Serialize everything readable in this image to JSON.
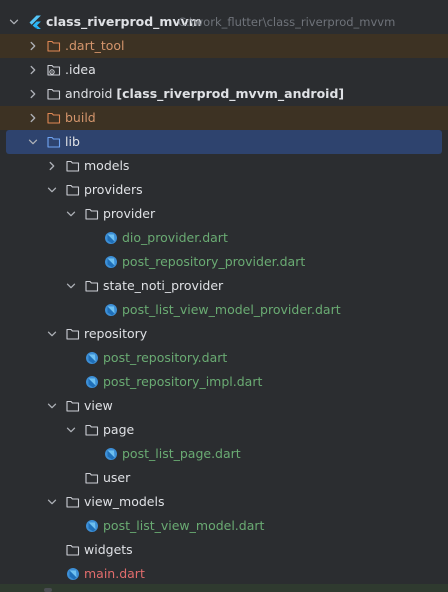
{
  "tree": {
    "root": {
      "label": "class_riverprod_mvvm",
      "path": "C:\\work_flutter\\class_riverprod_mvvm",
      "icon": "flutter-icon"
    },
    "dart_tool": {
      "label": ".dart_tool",
      "icon": "folder-excluded-icon"
    },
    "idea": {
      "label": ".idea",
      "icon": "folder-settings-icon"
    },
    "android": {
      "label": "android",
      "module": "[class_riverprod_mvvm_android]",
      "icon": "folder-icon"
    },
    "build": {
      "label": "build",
      "icon": "folder-excluded-icon"
    },
    "lib": {
      "label": "lib",
      "icon": "folder-icon"
    },
    "models": {
      "label": "models",
      "icon": "folder-icon"
    },
    "providers": {
      "label": "providers",
      "icon": "folder-icon"
    },
    "provider": {
      "label": "provider",
      "icon": "folder-icon"
    },
    "dio_provider": {
      "label": "dio_provider.dart",
      "icon": "dart-file-icon"
    },
    "post_repository_provider": {
      "label": "post_repository_provider.dart",
      "icon": "dart-file-icon"
    },
    "state_noti_provider": {
      "label": "state_noti_provider",
      "icon": "folder-icon"
    },
    "post_list_view_model_provider": {
      "label": "post_list_view_model_provider.dart",
      "icon": "dart-file-icon"
    },
    "repository": {
      "label": "repository",
      "icon": "folder-icon"
    },
    "post_repository": {
      "label": "post_repository.dart",
      "icon": "dart-file-icon"
    },
    "post_repository_impl": {
      "label": "post_repository_impl.dart",
      "icon": "dart-file-icon"
    },
    "view": {
      "label": "view",
      "icon": "folder-icon"
    },
    "page": {
      "label": "page",
      "icon": "folder-icon"
    },
    "post_list_page": {
      "label": "post_list_page.dart",
      "icon": "dart-file-icon"
    },
    "user": {
      "label": "user",
      "icon": "folder-icon"
    },
    "view_models": {
      "label": "view_models",
      "icon": "folder-icon"
    },
    "post_list_view_model": {
      "label": "post_list_view_model.dart",
      "icon": "dart-file-icon"
    },
    "widgets": {
      "label": "widgets",
      "icon": "folder-icon"
    },
    "main": {
      "label": "main.dart",
      "icon": "dart-file-icon"
    }
  },
  "colors": {
    "background": "#2b2d30",
    "selected_row": "#2e436e",
    "excluded_row": "#3d3223",
    "modified_file": "#6aab73",
    "excluded_label": "#d4956c",
    "error_file": "#e06c6c"
  }
}
